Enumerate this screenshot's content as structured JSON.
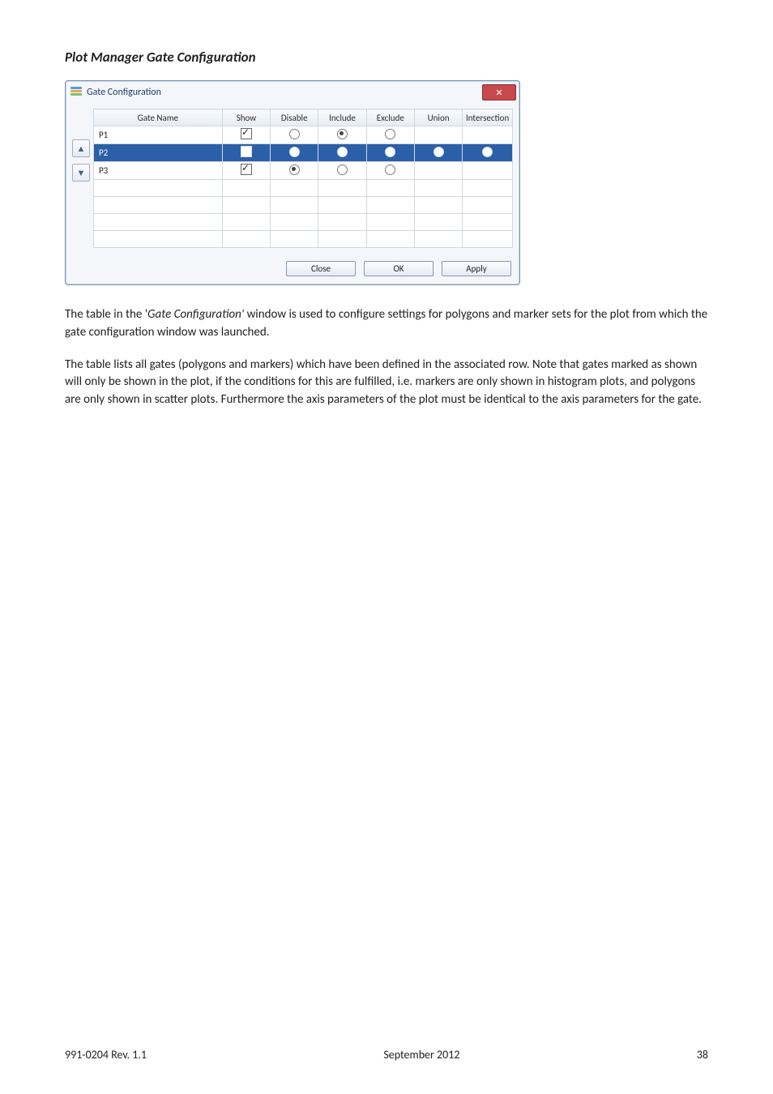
{
  "heading": "Plot Manager Gate Configuration",
  "window": {
    "title": "Gate Configuration",
    "columns": {
      "name": "Gate Name",
      "show": "Show",
      "disable": "Disable",
      "include": "Include",
      "exclude": "Exclude",
      "union": "Union",
      "intersection": "Intersection"
    },
    "rows": [
      {
        "name": "P1",
        "show": true,
        "mode": "include",
        "selected": false,
        "has_union": false
      },
      {
        "name": "P2",
        "show": true,
        "mode": "exclude",
        "selected": true,
        "has_union": true,
        "union": "off",
        "intersection": "on"
      },
      {
        "name": "P3",
        "show": true,
        "mode": "disable",
        "selected": false,
        "has_union": false
      }
    ],
    "buttons": {
      "close": "Close",
      "ok": "OK",
      "apply": "Apply"
    }
  },
  "paragraphs": {
    "p1a": "The table in the '",
    "p1b": "Gate Configuration'",
    "p1c": " window is used to configure settings for polygons and marker sets for the plot from which the gate configuration window was launched.",
    "p2": "The table lists all gates (polygons and markers) which have been defined in the associated row. Note that gates marked as shown will only be shown in the plot, if the conditions for this are fulfilled, i.e. markers are only shown in histogram plots, and polygons are only shown in scatter plots. Furthermore the axis parameters of the plot must be identical to the axis parameters for the gate."
  },
  "footer": {
    "left": "991-0204 Rev. 1.1",
    "center": "September 2012",
    "right": "38"
  }
}
